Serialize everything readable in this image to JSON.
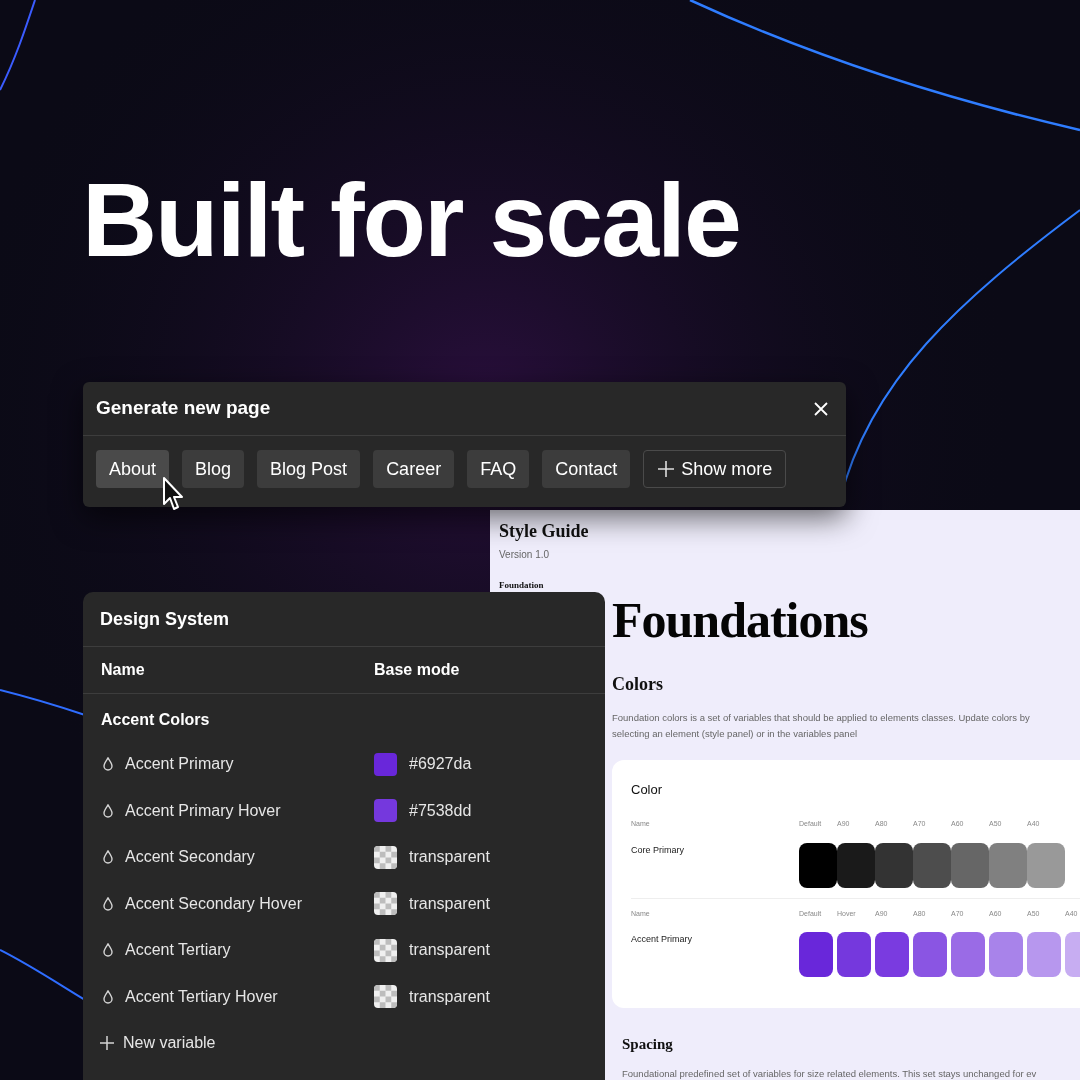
{
  "headline": "Built for scale",
  "generate_dialog": {
    "title": "Generate new page",
    "chips": [
      {
        "label": "About",
        "hovered": true
      },
      {
        "label": "Blog",
        "hovered": false
      },
      {
        "label": "Blog Post",
        "hovered": false
      },
      {
        "label": "Career",
        "hovered": false
      },
      {
        "label": "FAQ",
        "hovered": false
      },
      {
        "label": "Contact",
        "hovered": false
      }
    ],
    "show_more": "Show more"
  },
  "style_guide": {
    "title": "Style Guide",
    "version": "Version 1.0",
    "nav": [
      "Foundation"
    ],
    "heading": "Foundations",
    "colors_heading": "Colors",
    "colors_text": "Foundation colors is a set of variables that should be applied to elements classes. Update colors by selecting an element (style panel) or in the variables panel",
    "color_card": {
      "title": "Color",
      "groups": [
        {
          "name_label": "Name",
          "name": "Core Primary",
          "swatches": [
            {
              "label": "Default",
              "color": "#000000"
            },
            {
              "label": "A90",
              "color": "#1a1a1a"
            },
            {
              "label": "A80",
              "color": "#333333"
            },
            {
              "label": "A70",
              "color": "#4d4d4d"
            },
            {
              "label": "A60",
              "color": "#666666"
            },
            {
              "label": "A50",
              "color": "#808080"
            },
            {
              "label": "A40",
              "color": "#999999"
            }
          ]
        },
        {
          "name_label": "Name",
          "name": "Accent Primary",
          "swatches": [
            {
              "label": "Default",
              "color": "#6927da"
            },
            {
              "label": "Hover",
              "color": "#7538dd"
            },
            {
              "label": "A90",
              "color": "#7a3be0"
            },
            {
              "label": "A80",
              "color": "#8a55e3"
            },
            {
              "label": "A70",
              "color": "#9a6be6"
            },
            {
              "label": "A60",
              "color": "#a883ea"
            },
            {
              "label": "A50",
              "color": "#b797ee"
            },
            {
              "label": "A40",
              "color": "#c7adf2"
            }
          ]
        }
      ]
    },
    "spacing_heading": "Spacing",
    "spacing_text": "Foundational predefined set of variables for size related elements. This set stays unchanged for ev"
  },
  "design_system": {
    "title": "Design System",
    "columns": [
      "Name",
      "Base mode"
    ],
    "group": "Accent Colors",
    "variables": [
      {
        "name": "Accent Primary",
        "kind": "solid",
        "color": "#6927da",
        "value": "#6927da"
      },
      {
        "name": "Accent Primary Hover",
        "kind": "solid",
        "color": "#7538dd",
        "value": "#7538dd"
      },
      {
        "name": "Accent Secondary",
        "kind": "transparent",
        "value": "transparent"
      },
      {
        "name": "Accent Secondary Hover",
        "kind": "transparent",
        "value": "transparent"
      },
      {
        "name": "Accent Tertiary",
        "kind": "transparent",
        "value": "transparent"
      },
      {
        "name": "Accent Tertiary Hover",
        "kind": "transparent",
        "value": "transparent"
      }
    ],
    "new_variable": "New variable"
  }
}
